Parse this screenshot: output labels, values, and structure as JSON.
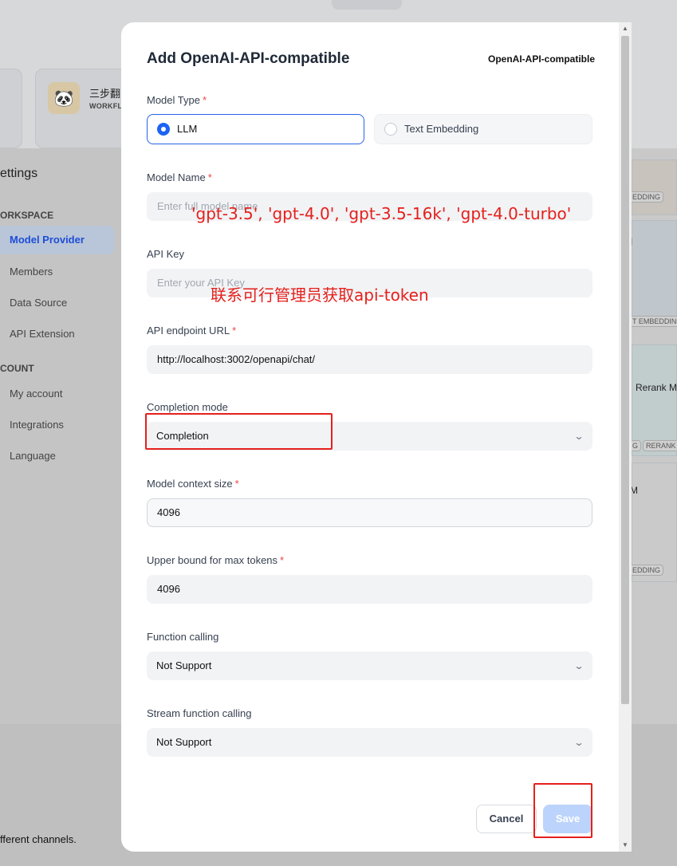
{
  "background": {
    "card": {
      "title": "三步翻",
      "subtitle": "WORKFL"
    },
    "settings": {
      "title": "ettings",
      "sections": {
        "workspace": "ORKSPACE",
        "account": "COUNT"
      },
      "items": [
        {
          "label": "Model Provider",
          "icon": "cube-icon"
        },
        {
          "label": "Members",
          "icon": "users-icon"
        },
        {
          "label": "Data Source",
          "icon": "database-icon"
        },
        {
          "label": "API Extension",
          "icon": "plug-icon"
        },
        {
          "label": "My account",
          "icon": "user-icon"
        },
        {
          "label": "Integrations",
          "icon": "grid-icon"
        },
        {
          "label": "Language",
          "icon": "globe-icon"
        }
      ]
    },
    "right_column": {
      "tag1": "EDDING",
      "text1": "I",
      "tag2": "T EMBEDDING",
      "text2": "Rerank Mo",
      "tag3a": "G",
      "tag3b": "RERANK",
      "text3": "M",
      "tag4": "EDDING"
    },
    "footer_text": "fferent channels."
  },
  "modal": {
    "title": "Add OpenAI-API-compatible",
    "provider_label": "OpenAI-API-compatible",
    "model_type": {
      "label": "Model Type",
      "required": "*",
      "options": [
        {
          "label": "LLM",
          "selected": true
        },
        {
          "label": "Text Embedding",
          "selected": false
        }
      ]
    },
    "model_name": {
      "label": "Model Name",
      "required": "*",
      "placeholder": "Enter full model name",
      "value": ""
    },
    "api_key": {
      "label": "API Key",
      "placeholder": "Enter your API Key",
      "value": ""
    },
    "api_endpoint": {
      "label": "API endpoint URL",
      "required": "*",
      "value": "http://localhost:3002/openapi/chat/"
    },
    "completion_mode": {
      "label": "Completion mode",
      "value": "Completion"
    },
    "context_size": {
      "label": "Model context size",
      "required": "*",
      "value": "4096"
    },
    "max_tokens": {
      "label": "Upper bound for max tokens",
      "required": "*",
      "value": "4096"
    },
    "function_calling": {
      "label": "Function calling",
      "value": "Not Support"
    },
    "stream_function_calling": {
      "label": "Stream function calling",
      "value": "Not Support"
    },
    "buttons": {
      "cancel": "Cancel",
      "save": "Save"
    }
  },
  "annotations": {
    "model_names": "'gpt-3.5', 'gpt-4.0', 'gpt-3.5-16k', 'gpt-4.0-turbo'",
    "api_key_note": "联系可行管理员获取api-token"
  },
  "colors": {
    "primary": "#1d64f2",
    "annotation": "#e5201c",
    "save_disabled": "#bcd4fb"
  }
}
